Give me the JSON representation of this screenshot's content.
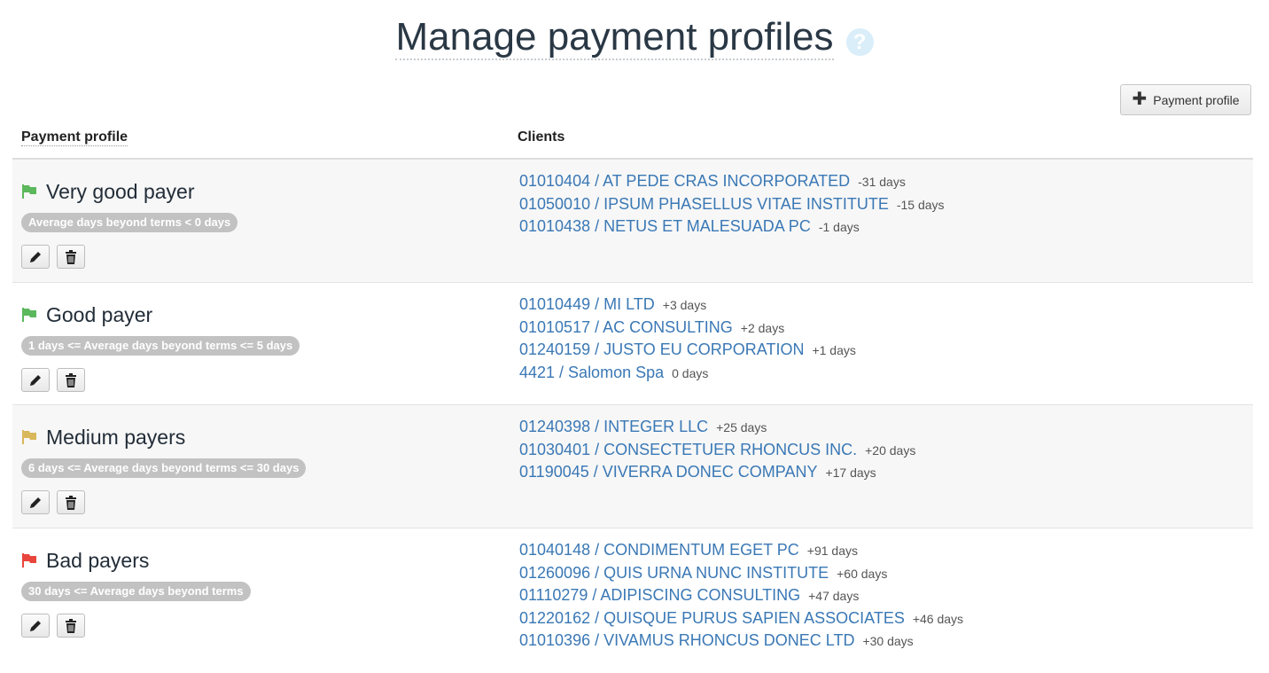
{
  "page": {
    "title": "Manage payment profiles",
    "help_icon": "question-circle-icon",
    "add_button_label": "Payment profile",
    "add_button_icon": "plus-icon"
  },
  "table": {
    "headers": {
      "profile": "Payment profile",
      "clients": "Clients"
    },
    "profiles": [
      {
        "name": "Very good payer",
        "flag_color": "#5cb85c",
        "criteria": "Average days beyond terms < 0 days",
        "clients": [
          {
            "label": "01010404 / AT PEDE CRAS INCORPORATED",
            "days": "-31 days"
          },
          {
            "label": "01050010 / IPSUM PHASELLUS VITAE INSTITUTE",
            "days": "-15 days"
          },
          {
            "label": "01010438 / NETUS ET MALESUADA PC",
            "days": "-1 days"
          }
        ]
      },
      {
        "name": "Good payer",
        "flag_color": "#5cb85c",
        "criteria": "1 days <= Average days beyond terms <= 5 days",
        "clients": [
          {
            "label": "01010449 / MI LTD",
            "days": "+3 days"
          },
          {
            "label": "01010517 / AC CONSULTING",
            "days": "+2 days"
          },
          {
            "label": "01240159 / JUSTO EU CORPORATION",
            "days": "+1 days"
          },
          {
            "label": "4421 / Salomon Spa",
            "days": "0 days"
          }
        ]
      },
      {
        "name": "Medium payers",
        "flag_color": "#d9b85c",
        "criteria": "6 days <= Average days beyond terms <= 30 days",
        "clients": [
          {
            "label": "01240398 / INTEGER LLC",
            "days": "+25 days"
          },
          {
            "label": "01030401 / CONSECTETUER RHONCUS INC.",
            "days": "+20 days"
          },
          {
            "label": "01190045 / VIVERRA DONEC COMPANY",
            "days": "+17 days"
          }
        ]
      },
      {
        "name": "Bad payers",
        "flag_color": "#e8453c",
        "criteria": "30 days <= Average days beyond terms",
        "clients": [
          {
            "label": "01040148 / CONDIMENTUM EGET PC",
            "days": "+91 days"
          },
          {
            "label": "01260096 / QUIS URNA NUNC INSTITUTE",
            "days": "+60 days"
          },
          {
            "label": "01110279 / ADIPISCING CONSULTING",
            "days": "+47 days"
          },
          {
            "label": "01220162 / QUISQUE PURUS SAPIEN ASSOCIATES",
            "days": "+46 days"
          },
          {
            "label": "01010396 / VIVAMUS RHONCUS DONEC LTD",
            "days": "+30 days"
          }
        ]
      }
    ]
  },
  "icons": {
    "flag": "flag-icon",
    "edit": "pencil-icon",
    "delete": "trash-icon"
  }
}
